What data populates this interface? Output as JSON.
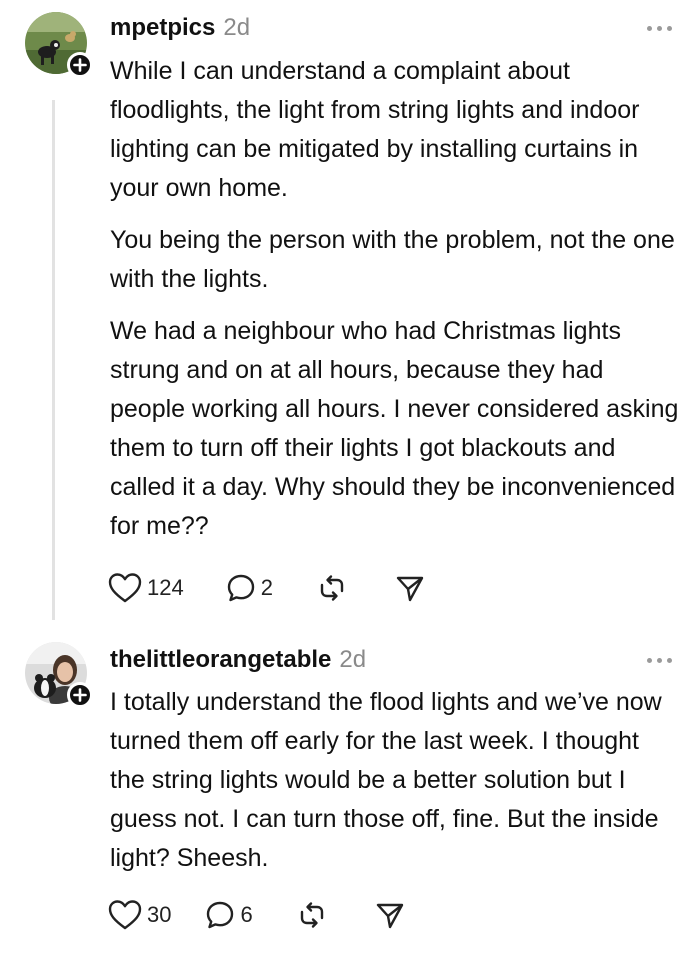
{
  "comments": [
    {
      "username": "mpetpics",
      "time": "2d",
      "paragraphs": [
        "While I can understand a complaint about floodlights, the light from string lights and indoor lighting can be mitigated by installing curtains in your own home.",
        "You being the person with the problem, not the one with the lights.",
        "We had a neighbour who had Christmas lights strung and on at all hours, because they had people working all hours. I never considered asking them to turn off their lights I got blackouts and called it a day. Why should they be inconvenienced for me??"
      ],
      "likes": "124",
      "replies": "2"
    },
    {
      "username": "thelittleorangetable",
      "time": "2d",
      "paragraphs": [
        "I totally understand the flood lights and we’ve now turned them off early for the last week. I thought the string lights would be a better solution but I guess not. I can turn those off, fine. But the inside light? Sheesh."
      ],
      "likes": "30",
      "replies": "6"
    }
  ],
  "icons": {
    "like": "heart-icon",
    "reply": "speech-bubble-icon",
    "restack": "restack-arrows-icon",
    "share": "paper-plane-icon",
    "more": "more-dots-icon",
    "follow": "plus-icon"
  },
  "colors": {
    "text": "#111111",
    "muted": "#8a8a8a",
    "thread_line": "#e2e2e2"
  }
}
